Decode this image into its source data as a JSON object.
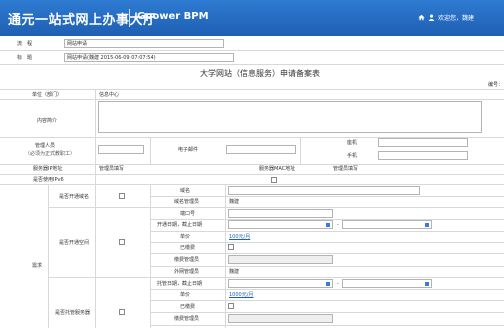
{
  "header": {
    "title": "通元一站式网上办事大厅",
    "brand": "Gpower BPM",
    "welcome": "欢迎您，魏建"
  },
  "info": {
    "type_label": "流　程",
    "type_value": "网站申请",
    "title_label": "标　题",
    "title_value": "网站申请(魏建 2015-06-09 07:07:54)"
  },
  "form": {
    "heading": "大学网站（信息服务）申请备案表",
    "serial_label": "编号：",
    "dept_label": "单位（部门）",
    "dept_value": "信息中心",
    "content_label": "内容简介",
    "admin_label": "管理人员",
    "admin_sub": "（必须为正式教职工）",
    "email_label": "电子邮件",
    "phone_label": "座机",
    "mobile_label": "手机",
    "server_ip_label": "服务器IP地址",
    "server_ip_value": "管理员填写",
    "server_mac_label": "服务器MAC地址",
    "server_mac_value": "管理员填写",
    "wireless_label": "是否使用IPv6",
    "demand_label": "需求",
    "domain_label": "是否开通域名",
    "domain_name_label": "域名",
    "domain_admin_label": "域名管理员",
    "domain_admin_value": "魏建",
    "space_label": "是否开通空间",
    "port_label": "端口号",
    "open_date_label": "开通日期，截止日期",
    "fee_label": "单价",
    "fee_value": "100元/月",
    "paid_label": "已缴费",
    "space_admin_label": "缴费管理员",
    "ext_admin_label": "外网管理员",
    "ext_admin_value": "魏建",
    "hosting_label": "是否托管服务器",
    "host_date_label": "托管日期，截止日期",
    "host_fee_label": "单价",
    "host_fee_value": "1000元/月",
    "host_paid_label": "已缴费",
    "host_admin_label": "缴费管理员"
  }
}
